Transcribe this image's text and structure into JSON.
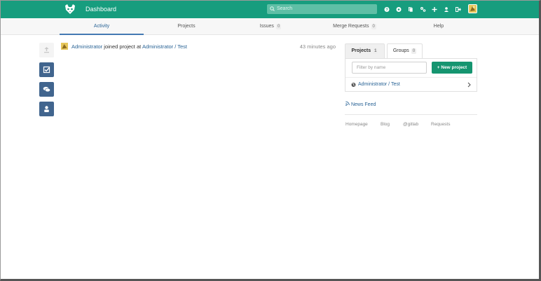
{
  "header": {
    "title": "Dashboard",
    "search_placeholder": "Search",
    "icons": [
      "help-icon",
      "explore-icon",
      "snippets-icon",
      "admin-area-icon",
      "new-project-icon",
      "profile-icon",
      "sign-out-icon"
    ]
  },
  "nav": {
    "tabs": [
      {
        "label": "Activity",
        "count": null
      },
      {
        "label": "Projects",
        "count": null
      },
      {
        "label": "Issues",
        "count": "0"
      },
      {
        "label": "Merge Requests",
        "count": "0"
      },
      {
        "label": "Help",
        "count": null
      }
    ]
  },
  "event": {
    "user": "Administrator",
    "action": "joined project",
    "at": "at",
    "project": "Administrator / Test",
    "time": "43 minutes ago"
  },
  "panel": {
    "tabs": [
      {
        "label": "Projects",
        "count": "1"
      },
      {
        "label": "Groups",
        "count": "0"
      }
    ],
    "filter_placeholder": "Filter by name",
    "new_project": "New project",
    "project_name": "Administrator / Test",
    "news_feed": "News Feed"
  },
  "footer": {
    "links": [
      "Homepage",
      "Blog",
      "@gitlab",
      "Requests"
    ]
  },
  "colors": {
    "header": "#179d7e",
    "sidebar_button": "#41658e",
    "link": "#2a6496",
    "primary_button": "#159570"
  }
}
